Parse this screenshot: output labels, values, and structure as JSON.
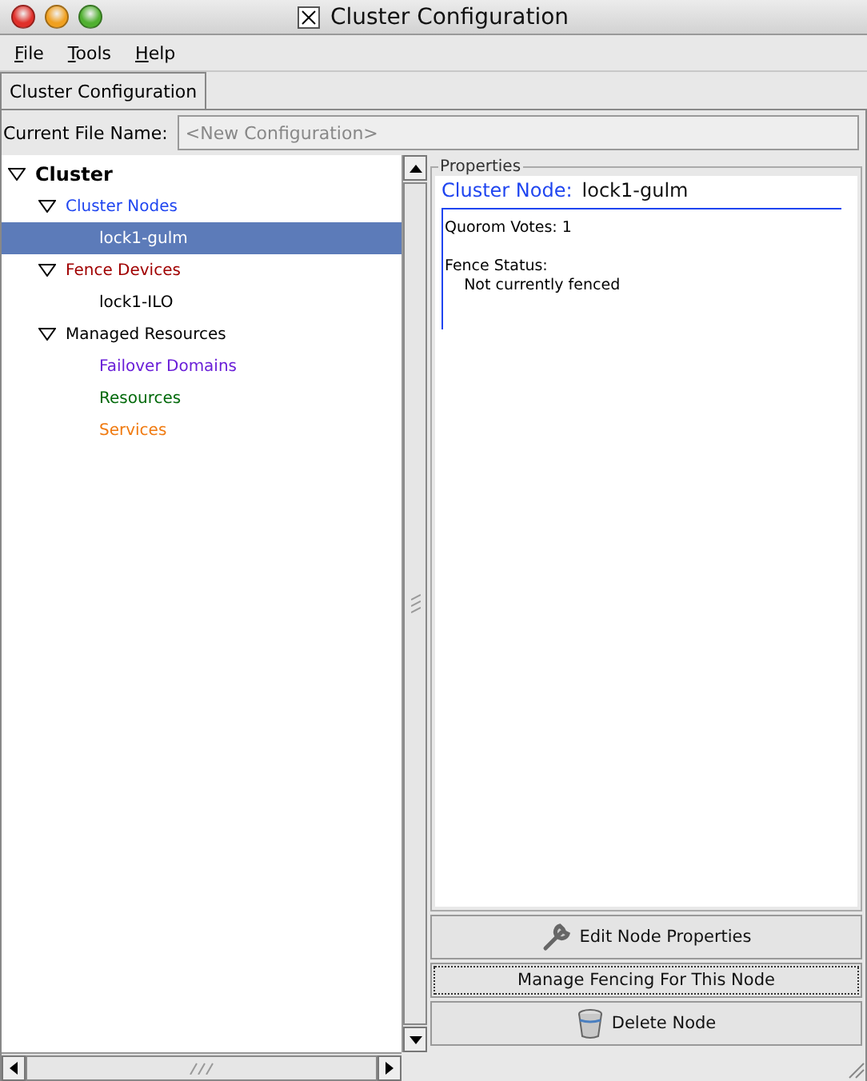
{
  "window": {
    "title": "Cluster Configuration"
  },
  "menu": [
    "File",
    "Tools",
    "Help"
  ],
  "tabs": [
    {
      "label": "Cluster Configuration",
      "selected": true
    }
  ],
  "file_name": {
    "label": "Current File Name:",
    "placeholder": "<New Configuration>"
  },
  "tree": [
    {
      "label": "Cluster",
      "color": "#000000",
      "selected": false,
      "expanded": true,
      "children": [
        {
          "label": "Cluster Nodes",
          "color": "#1f45f0",
          "selected": false,
          "expanded": true,
          "children": [
            {
              "label": "lock1-gulm",
              "color": "#ffffff",
              "selected": true
            }
          ]
        },
        {
          "label": "Fence Devices",
          "color": "#a00000",
          "selected": false,
          "expanded": true,
          "children": [
            {
              "label": "lock1-ILO",
              "color": "#000000",
              "selected": false
            }
          ]
        },
        {
          "label": "Managed Resources",
          "color": "#000000",
          "selected": false,
          "expanded": true,
          "children": [
            {
              "label": "Failover Domains",
              "color": "#6a1fd8",
              "selected": false
            },
            {
              "label": "Resources",
              "color": "#00690a",
              "selected": false
            },
            {
              "label": "Services",
              "color": "#f07a10",
              "selected": false
            }
          ]
        }
      ]
    }
  ],
  "properties": {
    "legend": "Properties",
    "heading_label": "Cluster Node:",
    "heading_value": "lock1-gulm",
    "groups": [
      [
        "Quorom Votes: 1"
      ],
      [
        "Fence Status:",
        "    Not currently fenced"
      ]
    ]
  },
  "buttons": [
    {
      "label": "Edit Node Properties",
      "kind": "wrench",
      "focused": false
    },
    {
      "label": "Manage Fencing For This Node",
      "kind": "plain",
      "focused": true
    },
    {
      "label": "Delete Node",
      "kind": "trash",
      "focused": false
    }
  ]
}
